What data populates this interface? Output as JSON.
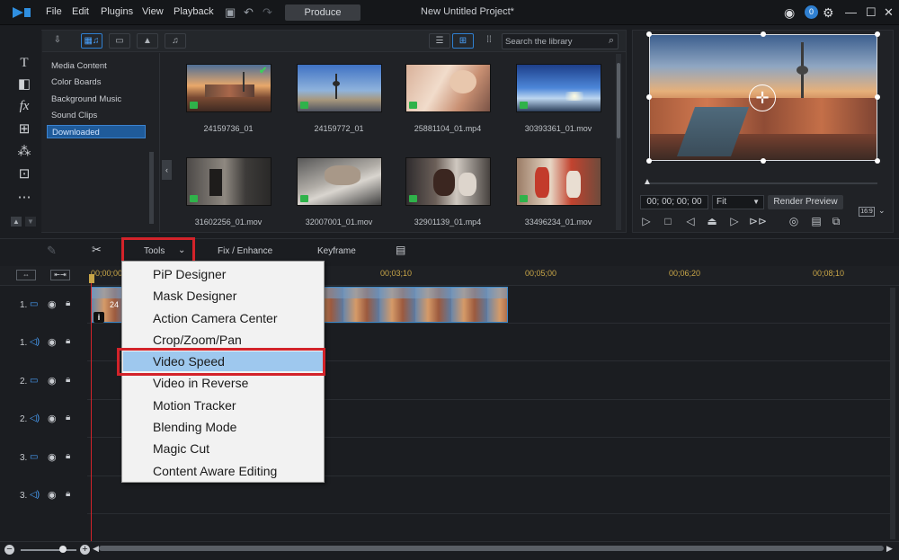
{
  "titlebar": {
    "menus": [
      "File",
      "Edit",
      "Plugins",
      "View",
      "Playback"
    ],
    "produce_label": "Produce",
    "project_title": "New Untitled Project*"
  },
  "library": {
    "search_placeholder": "Search the library",
    "categories": [
      "Media Content",
      "Color Boards",
      "Background Music",
      "Sound Clips",
      "Downloaded"
    ],
    "selected_category": "Downloaded",
    "items": [
      {
        "name": "24159736_01",
        "checked": true
      },
      {
        "name": "24159772_01"
      },
      {
        "name": "25881104_01.mp4"
      },
      {
        "name": "30393361_01.mov"
      },
      {
        "name": "31602256_01.mov"
      },
      {
        "name": "32007001_01.mov"
      },
      {
        "name": "32901139_01.mp4"
      },
      {
        "name": "33496234_01.mov"
      }
    ]
  },
  "preview": {
    "timecode": "00; 00; 00; 00",
    "fit_label": "Fit",
    "render_label": "Render Preview",
    "aspect_label": "16:9"
  },
  "edit_toolbar": {
    "tools_label": "Tools",
    "fix_label": "Fix / Enhance",
    "keyframe_label": "Keyframe"
  },
  "timeline": {
    "ruler": [
      "00;00;00",
      "00;03;10",
      "00;05;00",
      "00;06;20",
      "00;08;10"
    ],
    "tracks": [
      {
        "num": "1.",
        "type": "video"
      },
      {
        "num": "1.",
        "type": "audio"
      },
      {
        "num": "2.",
        "type": "video"
      },
      {
        "num": "2.",
        "type": "audio"
      },
      {
        "num": "3.",
        "type": "video"
      },
      {
        "num": "3.",
        "type": "audio"
      }
    ],
    "clip_label": "24"
  },
  "tools_menu": {
    "items": [
      "PiP Designer",
      "Mask Designer",
      "Action Camera Center",
      "Crop/Zoom/Pan",
      "Video Speed",
      "Video in Reverse",
      "Motion Tracker",
      "Blending Mode",
      "Magic Cut",
      "Content Aware Editing"
    ],
    "highlighted": "Video Speed"
  },
  "colors": {
    "accent": "#3b83cf",
    "highlight_frame": "#d3232a",
    "menu_highlight": "#9ec8ee",
    "ruler_text": "#c9a648"
  }
}
